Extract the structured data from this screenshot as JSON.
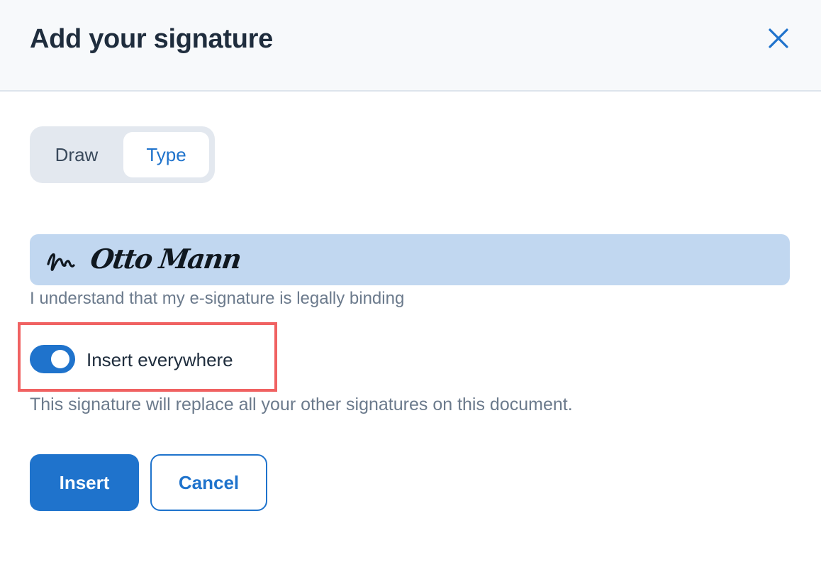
{
  "dialog": {
    "title": "Add your signature",
    "close_icon": "close-icon"
  },
  "mode_tabs": {
    "items": [
      {
        "label": "Draw",
        "selected": false
      },
      {
        "label": "Type",
        "selected": true
      }
    ]
  },
  "signature": {
    "value": "Otto Mann",
    "legal_notice": "I understand that my e-signature is legally binding"
  },
  "insert_everywhere": {
    "label": "Insert everywhere",
    "enabled": true,
    "description": "This signature will replace all your other signatures on this document."
  },
  "actions": {
    "insert_label": "Insert",
    "cancel_label": "Cancel"
  },
  "colors": {
    "accent": "#1f73cc",
    "highlight": "#f06262",
    "signature_field_bg": "#c1d7f0"
  }
}
